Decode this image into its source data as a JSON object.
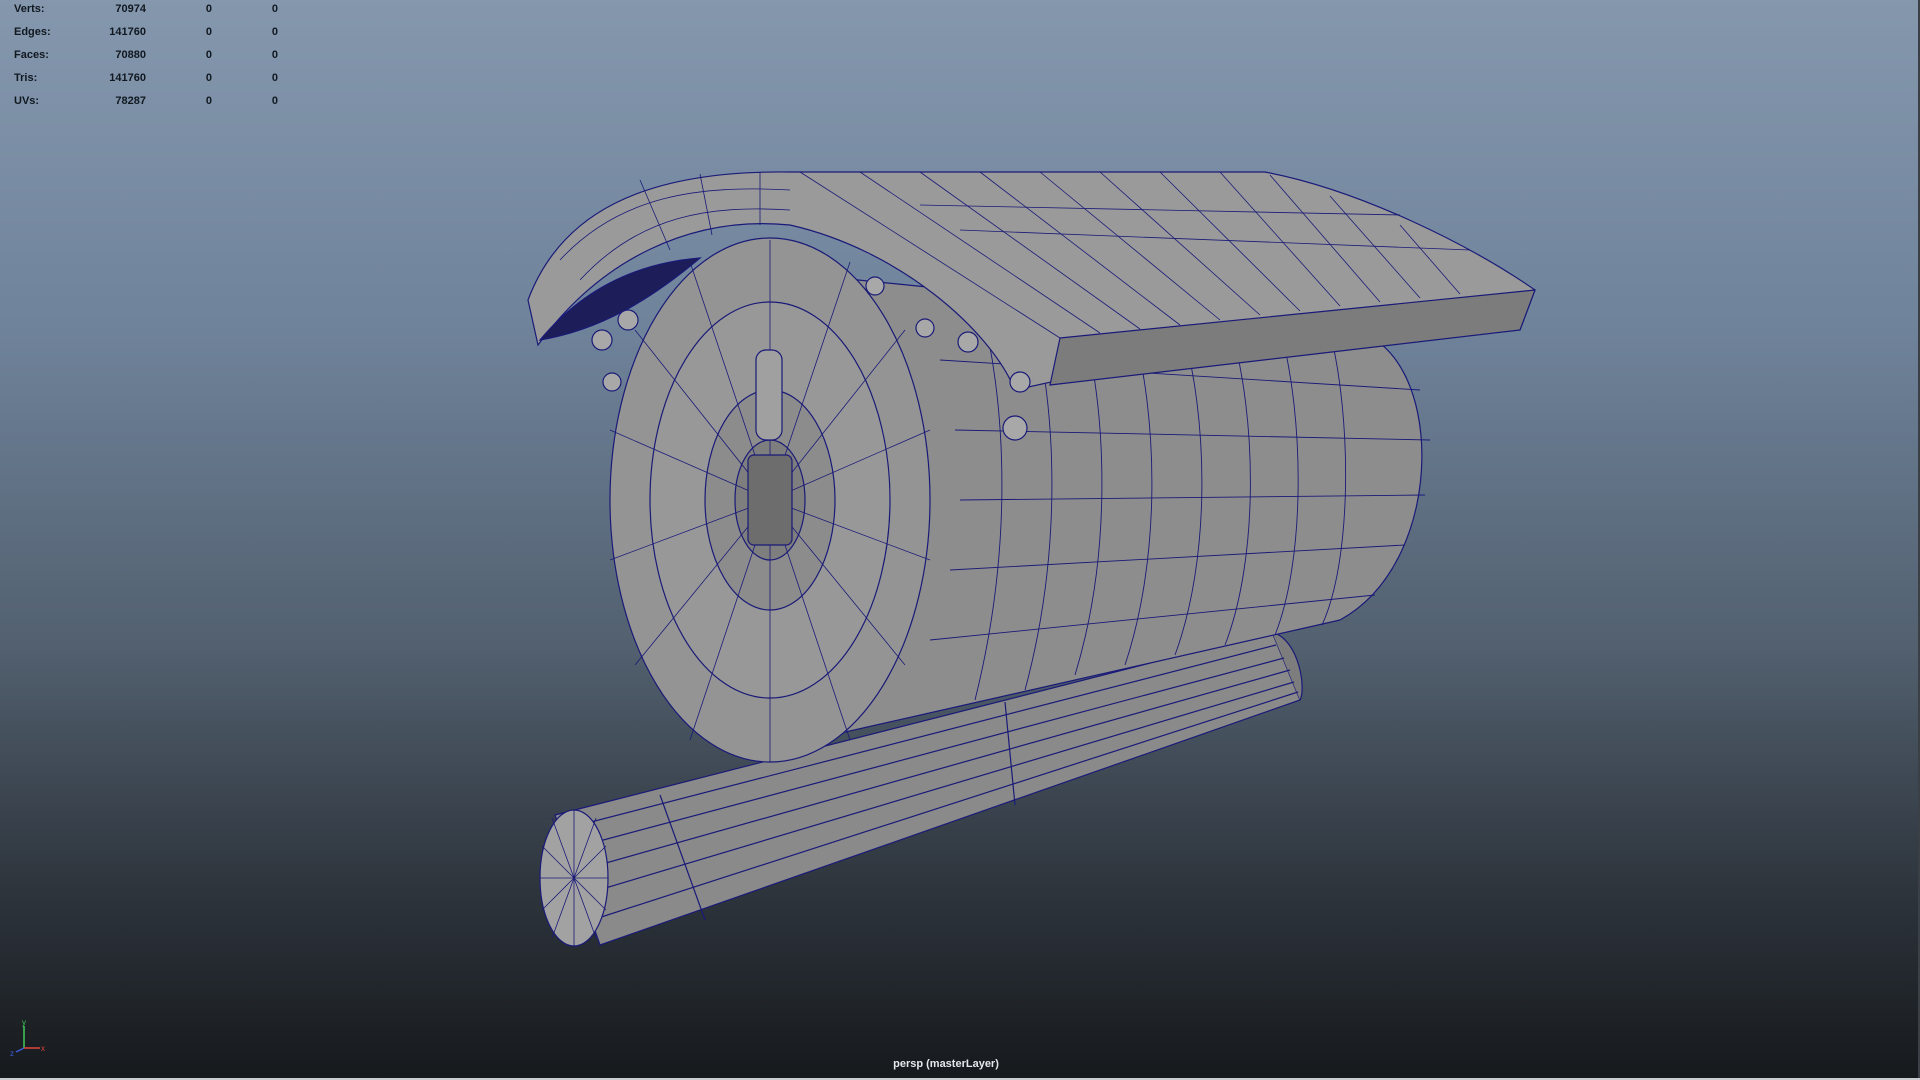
{
  "heads_up": {
    "rows": [
      {
        "label": "Verts:",
        "values": [
          "70974",
          "0",
          "0"
        ]
      },
      {
        "label": "Edges:",
        "values": [
          "141760",
          "0",
          "0"
        ]
      },
      {
        "label": "Faces:",
        "values": [
          "70880",
          "0",
          "0"
        ]
      },
      {
        "label": "Tris:",
        "values": [
          "141760",
          "0",
          "0"
        ]
      },
      {
        "label": "UVs:",
        "values": [
          "78287",
          "0",
          "0"
        ]
      }
    ]
  },
  "camera_label": "persp (masterLayer)",
  "axis_indicator": {
    "y": "y",
    "x": "x",
    "z": "z"
  },
  "colors": {
    "wireframe": "#1a1a78",
    "shaded": "#8f8f8f",
    "viewport_top": "#8497ad",
    "viewport_bottom": "#16191c"
  },
  "icons": [
    "axis-gizmo-icon"
  ]
}
